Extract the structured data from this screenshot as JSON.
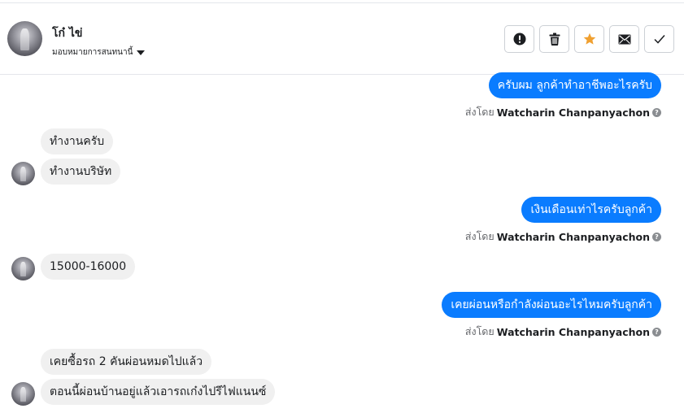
{
  "header": {
    "name": "โก๋ ไข่",
    "assign_label": "มอบหมายการสนทนานี้"
  },
  "toolbar": {
    "buttons": [
      {
        "icon": "exclamation-icon",
        "color": "#1c1e21"
      },
      {
        "icon": "trash-icon",
        "color": "#1c1e21"
      },
      {
        "icon": "star-icon",
        "color": "#f0a030"
      },
      {
        "icon": "envelope-icon",
        "color": "#1c1e21"
      },
      {
        "icon": "check-icon",
        "color": "#1c1e21"
      }
    ]
  },
  "colors": {
    "outgoing_bubble": "#0a7cff",
    "incoming_bubble": "#f0f0f0"
  },
  "messages": [
    {
      "dir": "out",
      "text": "ครับผม ลูกค้าทำอาชีพอะไรครับ"
    },
    {
      "dir": "in",
      "text": "ทำงานครับ"
    },
    {
      "dir": "in",
      "text": "ทำงานบริษัท"
    },
    {
      "dir": "out",
      "text": "เงินเดือนเท่าไรครับลูกค้า"
    },
    {
      "dir": "in",
      "text": "15000-16000"
    },
    {
      "dir": "out",
      "text": "เคยผ่อนหรือกำลังผ่อนอะไรไหมครับลูกค้า"
    },
    {
      "dir": "in",
      "text": "เคยซื้อรถ 2 คันผ่อนหมดไปแล้ว"
    },
    {
      "dir": "in",
      "text": "ตอนนี้ผ่อนบ้านอยู่แล้วเอารถเก๋งไปรีไฟแนนซ์"
    }
  ],
  "sent_by": {
    "prefix": "ส่งโดย",
    "agent": "Watcharin Chanpanyachon"
  }
}
